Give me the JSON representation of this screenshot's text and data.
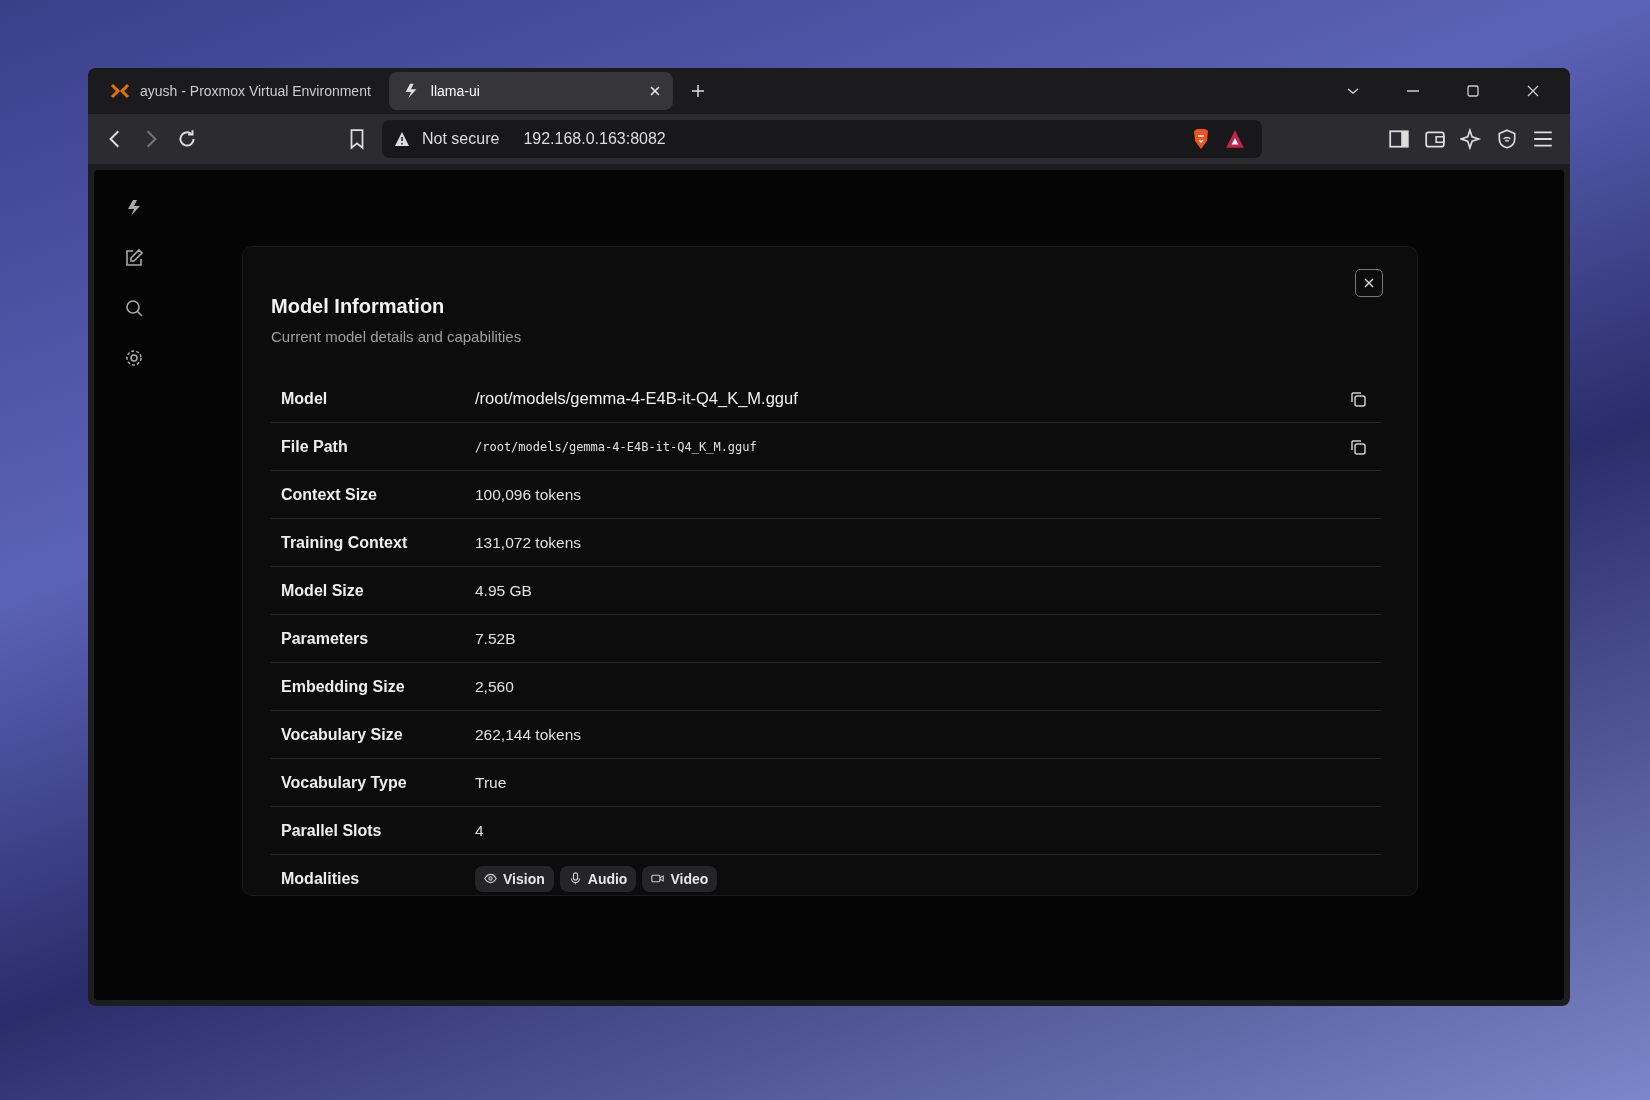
{
  "browser": {
    "tabs": [
      {
        "title": "ayush - Proxmox Virtual Environment",
        "selected": false
      },
      {
        "title": "llama-ui",
        "selected": true
      }
    ],
    "address": {
      "security": "Not secure",
      "url": "192.168.0.163:8082"
    }
  },
  "modal": {
    "title": "Model Information",
    "subtitle": "Current model details and capabilities",
    "rows": [
      {
        "label": "Model",
        "kind": "model",
        "value": "/root/models/gemma-4-E4B-it-Q4_K_M.gguf",
        "copyable": true
      },
      {
        "label": "File Path",
        "kind": "mono",
        "value": "/root/models/gemma-4-E4B-it-Q4_K_M.gguf",
        "copyable": true
      },
      {
        "label": "Context Size",
        "kind": "text",
        "value": "100,096 tokens",
        "copyable": false
      },
      {
        "label": "Training Context",
        "kind": "text",
        "value": "131,072 tokens",
        "copyable": false
      },
      {
        "label": "Model Size",
        "kind": "text",
        "value": "4.95 GB",
        "copyable": false
      },
      {
        "label": "Parameters",
        "kind": "text",
        "value": "7.52B",
        "copyable": false
      },
      {
        "label": "Embedding Size",
        "kind": "text",
        "value": "2,560",
        "copyable": false
      },
      {
        "label": "Vocabulary Size",
        "kind": "text",
        "value": "262,144 tokens",
        "copyable": false
      },
      {
        "label": "Vocabulary Type",
        "kind": "text",
        "value": "True",
        "copyable": false
      },
      {
        "label": "Parallel Slots",
        "kind": "text",
        "value": "4",
        "copyable": false
      },
      {
        "label": "Modalities",
        "kind": "chips",
        "chips": [
          {
            "label": "Vision"
          },
          {
            "label": "Audio"
          },
          {
            "label": "Video"
          }
        ],
        "copyable": false
      }
    ]
  }
}
